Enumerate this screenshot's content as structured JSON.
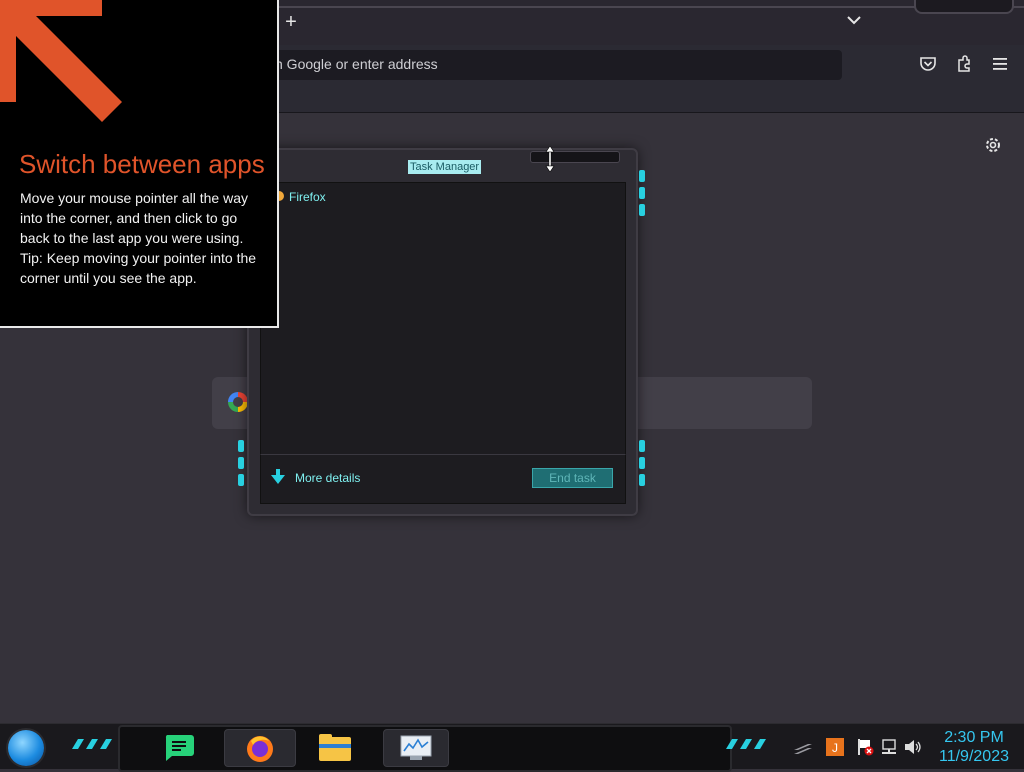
{
  "browser": {
    "new_tab_label": "+",
    "url_placeholder": "h Google or enter address"
  },
  "tip": {
    "title": "Switch between apps",
    "body_line1": "Move your mouse pointer all the way into the corner, and then click to go back to the last app you were using.",
    "body_line2": "Tip: Keep moving your pointer into the corner until you see the app."
  },
  "task_manager": {
    "title": "Task Manager",
    "processes": [
      {
        "name": "Firefox"
      }
    ],
    "more_details_label": "More details",
    "end_task_label": "End task"
  },
  "taskbar": {
    "apps": [
      {
        "name": "notes-app",
        "active": false
      },
      {
        "name": "firefox",
        "active": true
      },
      {
        "name": "file-explorer",
        "active": false
      },
      {
        "name": "task-manager",
        "active": true
      }
    ],
    "clock": {
      "time": "2:30 PM",
      "date": "11/9/2023"
    }
  },
  "colors": {
    "accent_cyan": "#28d0e0",
    "tip_title_orange": "#e0542a",
    "clock_blue": "#35c7f0"
  }
}
